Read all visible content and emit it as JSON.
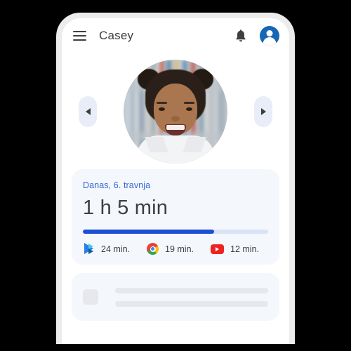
{
  "app_bar": {
    "menu_icon": "hamburger-menu-icon",
    "title": "Casey",
    "bell_icon": "notification-bell-icon",
    "avatar_icon": "account-avatar-icon"
  },
  "carousel": {
    "prev_icon": "chevron-left-icon",
    "next_icon": "chevron-right-icon",
    "photo_alt": "child-profile-photo"
  },
  "usage_card": {
    "date_label": "Danas, 6. travnja",
    "total_time": "1 h 5 min",
    "progress_percent": 71,
    "colors": {
      "accent": "#3566d6",
      "progress_fill": "#1a4fd6",
      "progress_track": "#d8e3f7",
      "card_bg": "#f4f7fb"
    },
    "apps": [
      {
        "icon": "google-play-icon",
        "time": "24 min."
      },
      {
        "icon": "google-chrome-icon",
        "time": "19 min."
      },
      {
        "icon": "youtube-icon",
        "time": "12 min."
      }
    ]
  },
  "skeleton_card": {
    "thumb": "placeholder-thumbnail",
    "lines": 2
  }
}
